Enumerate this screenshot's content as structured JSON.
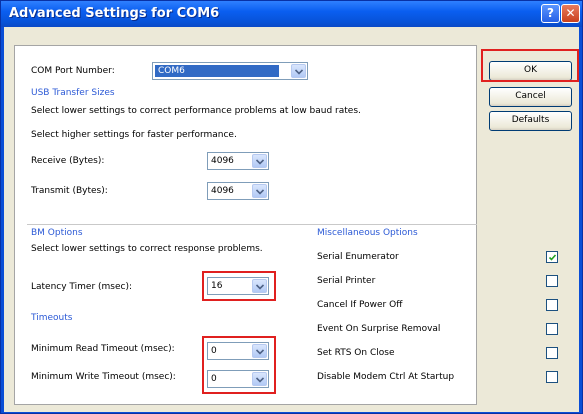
{
  "window": {
    "title": "Advanced Settings for COM6"
  },
  "com_port": {
    "label": "COM Port Number:",
    "value": "COM6"
  },
  "usb": {
    "heading": "USB Transfer Sizes",
    "hint_lower": "Select lower settings to correct performance problems at low baud rates.",
    "hint_higher": "Select higher settings for faster performance.",
    "receive_label": "Receive (Bytes):",
    "receive_value": "4096",
    "transmit_label": "Transmit (Bytes):",
    "transmit_value": "4096"
  },
  "bm": {
    "heading": "BM Options",
    "hint": "Select lower settings to correct response problems.",
    "latency_label": "Latency Timer (msec):",
    "latency_value": "16"
  },
  "timeouts": {
    "heading": "Timeouts",
    "read_label": "Minimum Read Timeout (msec):",
    "read_value": "0",
    "write_label": "Minimum Write Timeout (msec):",
    "write_value": "0"
  },
  "misc": {
    "heading": "Miscellaneous Options",
    "options": [
      {
        "label": "Serial Enumerator",
        "checked": true
      },
      {
        "label": "Serial Printer",
        "checked": false
      },
      {
        "label": "Cancel If Power Off",
        "checked": false
      },
      {
        "label": "Event On Surprise Removal",
        "checked": false
      },
      {
        "label": "Set RTS On Close",
        "checked": false
      },
      {
        "label": "Disable Modem Ctrl At Startup",
        "checked": false
      }
    ]
  },
  "buttons": {
    "ok": "OK",
    "cancel": "Cancel",
    "defaults": "Defaults"
  },
  "colors": {
    "title_bar": "#0a5ef0",
    "section_heading": "#2c5ad6",
    "highlight_box": "#e0201f"
  }
}
